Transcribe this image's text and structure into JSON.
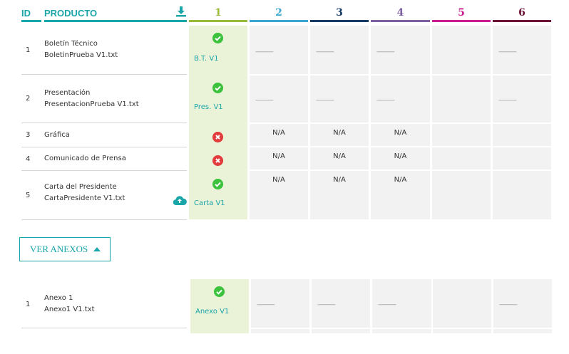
{
  "header": {
    "id_label": "ID",
    "producto_label": "PRODUCTO",
    "columns": [
      {
        "label": "1",
        "color": "#9aba3a"
      },
      {
        "label": "2",
        "color": "#3ba6cf"
      },
      {
        "label": "3",
        "color": "#163a66"
      },
      {
        "label": "4",
        "color": "#7b5f9e"
      },
      {
        "label": "5",
        "color": "#c91c8e"
      },
      {
        "label": "6",
        "color": "#6b1436"
      }
    ],
    "download_icon": "download-icon"
  },
  "rows": [
    {
      "id": "1",
      "title": "Boletín Técnico",
      "file": "BoletinPrueba V1.txt",
      "status": "check",
      "label": "B.T. V1",
      "cells": [
        "dash",
        "dash",
        "dash",
        "empty",
        "dash"
      ]
    },
    {
      "id": "2",
      "title": "Presentación",
      "file": "PresentacionPrueba V1.txt",
      "status": "check",
      "label": "Pres. V1",
      "cells": [
        "dash",
        "dash",
        "dash",
        "empty",
        "dash"
      ]
    },
    {
      "id": "3",
      "title": "Gráfica",
      "file": "",
      "status": "x",
      "label": "",
      "cells": [
        "N/A",
        "N/A",
        "N/A",
        "empty",
        "empty"
      ]
    },
    {
      "id": "4",
      "title": "Comunicado de Prensa",
      "file": "",
      "status": "x",
      "label": "",
      "cells": [
        "N/A",
        "N/A",
        "N/A",
        "empty",
        "empty"
      ]
    },
    {
      "id": "5",
      "title": "Carta del Presidente",
      "file": "CartaPresidente V1.txt",
      "status": "check",
      "label": "Carta V1",
      "cells": [
        "N/A",
        "N/A",
        "N/A",
        "empty",
        "empty"
      ],
      "upload_icon": "cloud-upload-icon"
    }
  ],
  "anexos_button": {
    "label": "VER ANEXOS",
    "icon": "caret-up-icon"
  },
  "anexos": [
    {
      "id": "1",
      "title": "Anexo 1",
      "file": "Anexo1 V1.txt",
      "status": "check",
      "label": "Anexo V1",
      "cells": [
        "dash",
        "dash",
        "dash",
        "empty",
        "dash"
      ]
    }
  ],
  "dash_text": "-----------"
}
